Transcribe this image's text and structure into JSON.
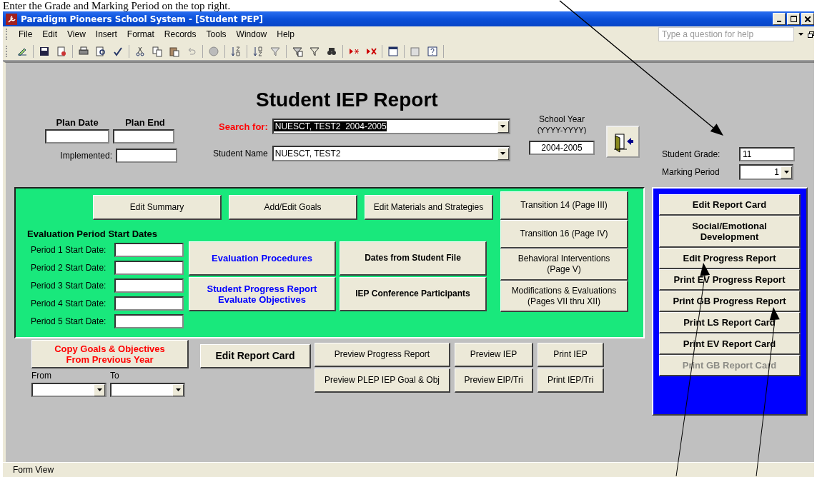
{
  "annotation": {
    "caption": "Enter the Grade and Marking Period on the top right."
  },
  "window": {
    "title": "Paradigm Pioneers School System - [Student PEP]"
  },
  "menu": [
    "File",
    "Edit",
    "View",
    "Insert",
    "Format",
    "Records",
    "Tools",
    "Window",
    "Help"
  ],
  "help_box": {
    "placeholder": "Type a question for help"
  },
  "form": {
    "title": "Student IEP Report",
    "plan": {
      "date_label": "Plan Date",
      "end_label": "Plan End",
      "implemented_label": "Implemented:"
    },
    "search": {
      "label": "Search for:",
      "value": "NUESCT, TEST2  2004-2005",
      "highlighted": true
    },
    "student_name": {
      "label": "Student Name",
      "value": "NUESCT, TEST2"
    },
    "school_year": {
      "label": "School Year",
      "format": "(YYYY-YYYY)",
      "value": "2004-2005"
    },
    "student_grade": {
      "label": "Student Grade:",
      "value": "11"
    },
    "marking_period": {
      "label": "Marking Period",
      "value": "1"
    },
    "main_panel": {
      "top_buttons": [
        "Edit Summary",
        "Add/Edit Goals",
        "Edit Materials and Strategies"
      ],
      "transition_buttons": [
        "Transition 14 (Page III)",
        "Transition 16 (Page IV)",
        "Behavioral Interventions\n(Page V)",
        "Modifications & Evaluations\n(Pages VII thru XII)"
      ],
      "evaluation": {
        "heading": "Evaluation Period Start  Dates",
        "periods": [
          "Period 1 Start Date:",
          "Period 2 Start Date:",
          "Period 3 Start Date:",
          "Period 4 Start Date:",
          "Period 5 Start Date:"
        ]
      },
      "mid_buttons": [
        {
          "label": "Evaluation Procedures",
          "kind": "blue"
        },
        {
          "label": "Dates from Student File",
          "kind": "bold"
        },
        {
          "label": "Student Progress Report\nEvaluate Objectives",
          "kind": "blue"
        },
        {
          "label": "IEP Conference Participants",
          "kind": "bold"
        }
      ]
    },
    "copy_button": {
      "label": "Copy Goals & Objectives\nFrom Previous Year",
      "kind": "red"
    },
    "from_label": "From",
    "to_label": "To",
    "edit_report_card": {
      "label": "Edit Report Card",
      "kind": "large"
    },
    "preview_buttons": [
      "Preview Progress Report",
      "Preview IEP",
      "Print IEP",
      "Preview PLEP IEP Goal & Obj",
      "Preview EIP/Tri",
      "Print IEP/Tri"
    ],
    "side_panel": {
      "buttons": [
        {
          "label": "Edit Report Card",
          "disabled": false
        },
        {
          "label": "Social/Emotional\nDevelopment",
          "disabled": false
        },
        {
          "label": "Edit Progress Report",
          "disabled": false
        },
        {
          "label": "Print EV Progress Report",
          "disabled": false
        },
        {
          "label": "Print GB Progress Report",
          "disabled": false
        },
        {
          "label": "Print LS Report Card",
          "disabled": false
        },
        {
          "label": "Print EV Report Card",
          "disabled": false
        },
        {
          "label": "Print  GB Report Card",
          "disabled": true
        }
      ]
    }
  },
  "status_bar": {
    "text": "Form View"
  }
}
